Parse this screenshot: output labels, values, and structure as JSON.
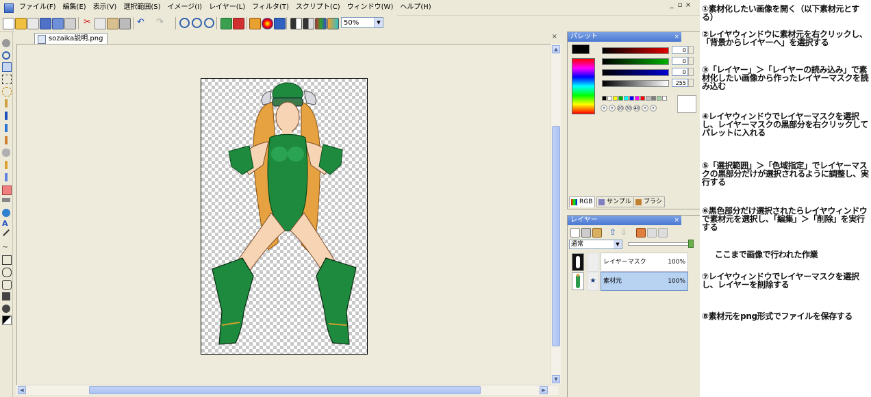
{
  "menubar": {
    "items": [
      "ファイル(F)",
      "編集(E)",
      "表示(V)",
      "選択範囲(S)",
      "イメージ(I)",
      "レイヤー(L)",
      "フィルタ(T)",
      "スクリプト(C)",
      "ウィンドウ(W)",
      "ヘルプ(H)"
    ],
    "window_controls": [
      "_",
      "▫",
      "×"
    ]
  },
  "toolbar": {
    "zoom_value": "50%"
  },
  "document": {
    "tab_title": "sozaika説明.png",
    "tab_close": "×"
  },
  "scroll_arrows": {
    "up": "▲",
    "down": "▼",
    "left": "◀",
    "right": "▶"
  },
  "palette": {
    "title": "パレット",
    "close": "×",
    "rgb_values": [
      "0",
      "0",
      "0",
      "255"
    ],
    "preset_labels": [
      "•",
      "•",
      "20",
      "30",
      "40",
      "•",
      "•"
    ],
    "tabs": [
      "RGB",
      "サンプル",
      "ブラシ"
    ],
    "colors": {
      "slider_red": "#e00000",
      "slider_green": "#00b000",
      "slider_blue": "#0000d0",
      "accent_title": "#4a78d2"
    },
    "mini_swatches": [
      "#000000",
      "#ffffff",
      "#ffff00",
      "#00b000",
      "#00ffff",
      "#0000ff",
      "#ff00ff",
      "#ff0000",
      "#c0c0c0",
      "#808080",
      "#a0d0a0",
      "#ffffff"
    ]
  },
  "layers": {
    "title": "レイヤー",
    "close": "×",
    "blend_mode": "通常",
    "rows": [
      {
        "name": "レイヤーマスク",
        "opacity": "100%",
        "mark": "",
        "selected": false
      },
      {
        "name": "素材元",
        "opacity": "100%",
        "mark": "★",
        "selected": true
      }
    ]
  },
  "instructions": {
    "steps": [
      "①素材化したい画像を開く（以下素材元とする）",
      "②レイヤウィンドウに素材元を右クリックし、「背景からレイヤーへ」を選択する",
      "③「レイヤー」＞「レイヤーの読み込み」で素材化したい画像から作ったレイヤーマスクを読み込む",
      "④レイヤウィンドウでレイヤーマスクを選択し、レイヤーマスクの黒部分を右クリックしてパレットに入れる",
      "⑤「選択範囲」＞「色域指定」でレイヤーマスクの黒部分だけが選択されるように調整し、実行する",
      "⑥黒色部分だけ選択されたらレイヤウィンドウで素材元を選択し、「編集」＞「削除」を実行する",
      "ここまで画像で行われた作業",
      "⑦レイヤウィンドウでレイヤーマスクを選択し、レイヤーを削除する",
      "⑧素材元をpng形式でファイルを保存する"
    ]
  }
}
